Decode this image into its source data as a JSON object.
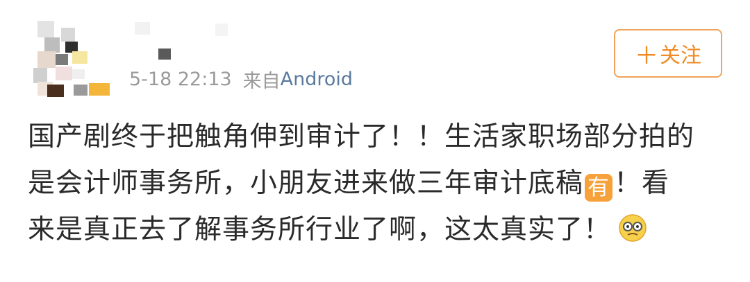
{
  "post": {
    "timestamp": "5-18 22:13",
    "source_prefix": "来自",
    "source_app": "Android",
    "lines": [
      "国产剧终于把触角伸到审计了！！生活家职场部分拍的",
      "是会计师事务所，小朋友进来做三年审计底稿",
      "！看",
      "来是真正去了解事务所行业了啊，这太真实了！"
    ],
    "badge_text": "有"
  },
  "follow_button": {
    "plus": "＋",
    "label": "关注"
  },
  "colors": {
    "accent": "#f08a24",
    "source_link": "#5a7a9e",
    "meta_gray": "#9a9a9a"
  },
  "icons": [
    "avatar-mosaic",
    "username-mosaic",
    "emoji-face-icon"
  ]
}
